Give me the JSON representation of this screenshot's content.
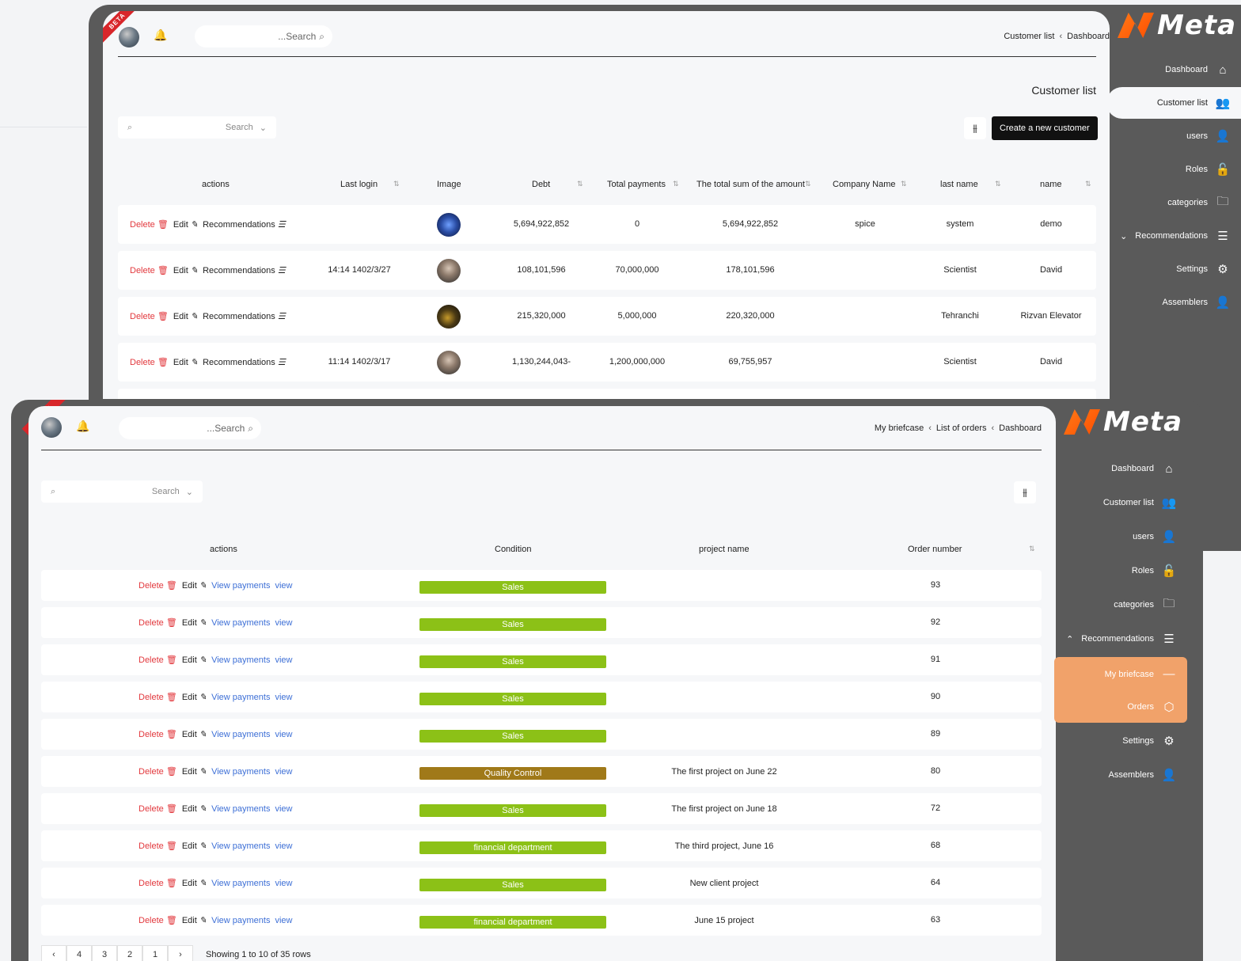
{
  "window1": {
    "top_search_placeholder": "...Search",
    "breadcrumb": [
      "Customer list",
      "Dashboard"
    ],
    "page_title": "Customer list",
    "filter_placeholder": "Search",
    "create_button": "Create a new customer",
    "headers": [
      "actions",
      "Last login",
      "Image",
      "Debt",
      "Total payments",
      "The total sum of the amount",
      "Company Name",
      "last name",
      "name"
    ],
    "action_labels": {
      "delete": "Delete",
      "edit": "Edit",
      "recommendations": "Recommendations"
    },
    "rows": [
      {
        "last_login": "",
        "debt": "5,694,922,852",
        "total_payments": "0",
        "total_sum": "5,694,922,852",
        "company": "spice",
        "last_name": "system",
        "name": "demo"
      },
      {
        "last_login": "14:14 1402/3/27",
        "debt": "108,101,596",
        "total_payments": "70,000,000",
        "total_sum": "178,101,596",
        "company": "",
        "last_name": "Scientist",
        "name": "David"
      },
      {
        "last_login": "",
        "debt": "215,320,000",
        "total_payments": "5,000,000",
        "total_sum": "220,320,000",
        "company": "",
        "last_name": "Tehranchi",
        "name": "Rizvan Elevator"
      },
      {
        "last_login": "11:14 1402/3/17",
        "debt": "1,130,244,043-",
        "total_payments": "1,200,000,000",
        "total_sum": "69,755,957",
        "company": "",
        "last_name": "Scientist",
        "name": "David"
      }
    ],
    "sidebar": {
      "logo_text": "Meta",
      "items": [
        {
          "label": "Dashboard",
          "icon": "home-icon"
        },
        {
          "label": "Customer list",
          "icon": "users-icon"
        },
        {
          "label": "users",
          "icon": "user-icon"
        },
        {
          "label": "Roles",
          "icon": "lock-icon"
        },
        {
          "label": "categories",
          "icon": "folder-icon"
        },
        {
          "label": "Recommendations",
          "icon": "list-icon"
        },
        {
          "label": "Settings",
          "icon": "gear-icon"
        },
        {
          "label": "Assemblers",
          "icon": "user-icon"
        }
      ]
    }
  },
  "window2": {
    "badge": "BETA",
    "top_search_placeholder": "...Search",
    "breadcrumb": [
      "My briefcase",
      "List of orders",
      "Dashboard"
    ],
    "filter_placeholder": "Search",
    "headers": [
      "actions",
      "Condition",
      "project name",
      "Order number"
    ],
    "action_labels": {
      "delete": "Delete",
      "edit": "Edit",
      "view_payments": "View payments",
      "view": "view"
    },
    "rows": [
      {
        "condition": "Sales",
        "project": "",
        "order": "93"
      },
      {
        "condition": "Sales",
        "project": "",
        "order": "92"
      },
      {
        "condition": "Sales",
        "project": "",
        "order": "91"
      },
      {
        "condition": "Sales",
        "project": "",
        "order": "90"
      },
      {
        "condition": "Sales",
        "project": "",
        "order": "89"
      },
      {
        "condition": "Quality Control",
        "project": "The first project on June 22",
        "order": "80"
      },
      {
        "condition": "Sales",
        "project": "The first project on June 18",
        "order": "72"
      },
      {
        "condition": "financial department",
        "project": "The third project, June 16",
        "order": "68"
      },
      {
        "condition": "Sales",
        "project": "New client project",
        "order": "64"
      },
      {
        "condition": "financial department",
        "project": "June 15 project",
        "order": "63"
      }
    ],
    "colors": {
      "sales": "#8cc117",
      "quality_control": "#a07919",
      "financial_department": "#8cc117",
      "orange_active": "#f1a26a"
    },
    "pagination": {
      "pages": [
        "4",
        "3",
        "2",
        "1"
      ],
      "info": "Showing 1 to 10 of 35 rows"
    },
    "sidebar": {
      "logo_text": "Meta",
      "items": [
        {
          "label": "Dashboard",
          "icon": "home-icon"
        },
        {
          "label": "Customer list",
          "icon": "users-icon"
        },
        {
          "label": "users",
          "icon": "user-icon"
        },
        {
          "label": "Roles",
          "icon": "lock-icon"
        },
        {
          "label": "categories",
          "icon": "folder-icon"
        },
        {
          "label": "Recommendations",
          "icon": "list-icon"
        },
        {
          "label": "My briefcase",
          "icon": "dash-icon"
        },
        {
          "label": "Orders",
          "icon": "box-icon"
        },
        {
          "label": "Settings",
          "icon": "gear-icon"
        },
        {
          "label": "Assemblers",
          "icon": "user-icon"
        }
      ]
    }
  }
}
